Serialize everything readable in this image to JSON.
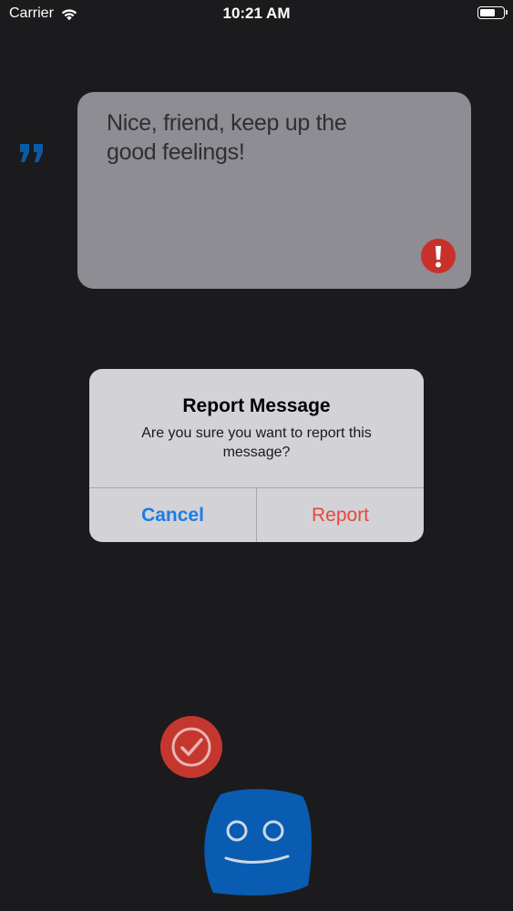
{
  "status_bar": {
    "carrier": "Carrier",
    "time": "10:21 AM",
    "battery_level": 0.7
  },
  "message": {
    "text": "Nice, friend, keep up the good feelings!",
    "quote_icon": "quote-icon",
    "report_icon": "exclamation-icon"
  },
  "dialog": {
    "title": "Report Message",
    "message": "Are you sure you want to report this message?",
    "cancel_label": "Cancel",
    "report_label": "Report"
  },
  "actions": {
    "check_icon": "check-circle-icon",
    "mascot_icon": "smiley-face-icon"
  },
  "colors": {
    "background": "#1b1b1d",
    "card": "#8e8d93",
    "accent_red": "#c5372e",
    "accent_blue": "#0b5aa8",
    "cancel_blue": "#1a7ee8",
    "report_red": "#e8483e"
  }
}
